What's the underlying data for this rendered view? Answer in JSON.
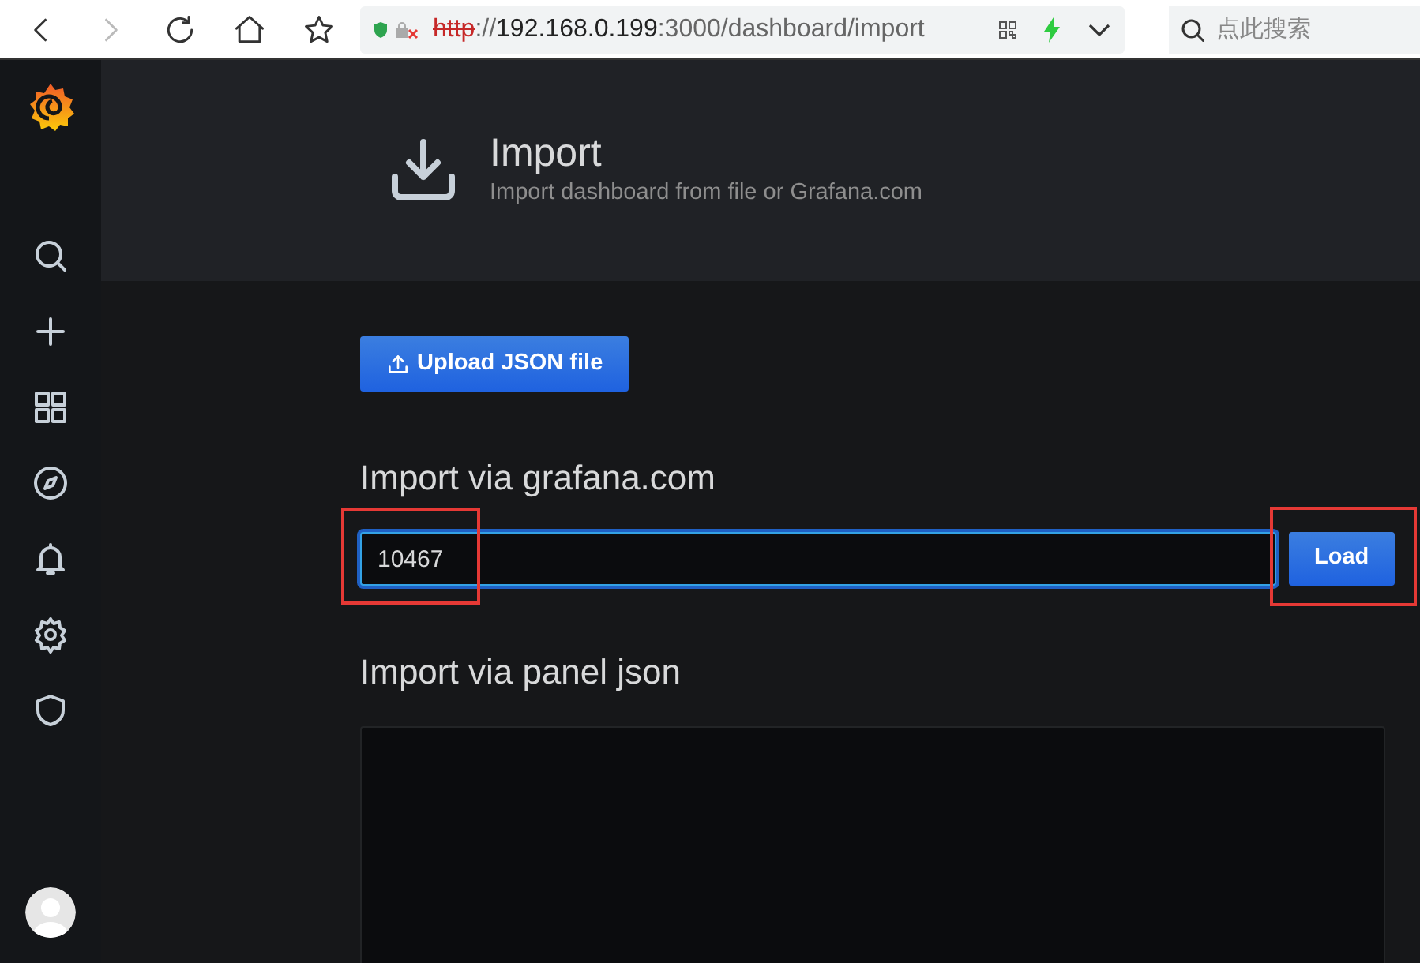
{
  "browser": {
    "nav_buttons": [
      {
        "kind": "back",
        "disabled": false
      },
      {
        "kind": "forward",
        "disabled": true
      },
      {
        "kind": "reload",
        "disabled": false
      },
      {
        "kind": "home",
        "disabled": false
      },
      {
        "kind": "bookmark",
        "disabled": false
      }
    ],
    "address": {
      "insecure": true,
      "scheme": "http",
      "separator": "://",
      "host": "192.168.0.199",
      "path": ":3000/dashboard/import"
    },
    "search": {
      "placeholder": "点此搜索"
    }
  },
  "sidebar": {
    "items": [
      {
        "kind": "search"
      },
      {
        "kind": "create"
      },
      {
        "kind": "dashboards"
      },
      {
        "kind": "explore"
      },
      {
        "kind": "alerting"
      },
      {
        "kind": "configuration"
      },
      {
        "kind": "admin"
      }
    ]
  },
  "header": {
    "title": "Import",
    "subtitle": "Import dashboard from file or Grafana.com"
  },
  "upload_button": "Upload JSON file",
  "grafana_section": {
    "heading": "Import via grafana.com",
    "value": "10467",
    "field_highlighted": true,
    "button": "Load",
    "button_highlighted": true
  },
  "panel_section": {
    "heading": "Import via panel json"
  }
}
